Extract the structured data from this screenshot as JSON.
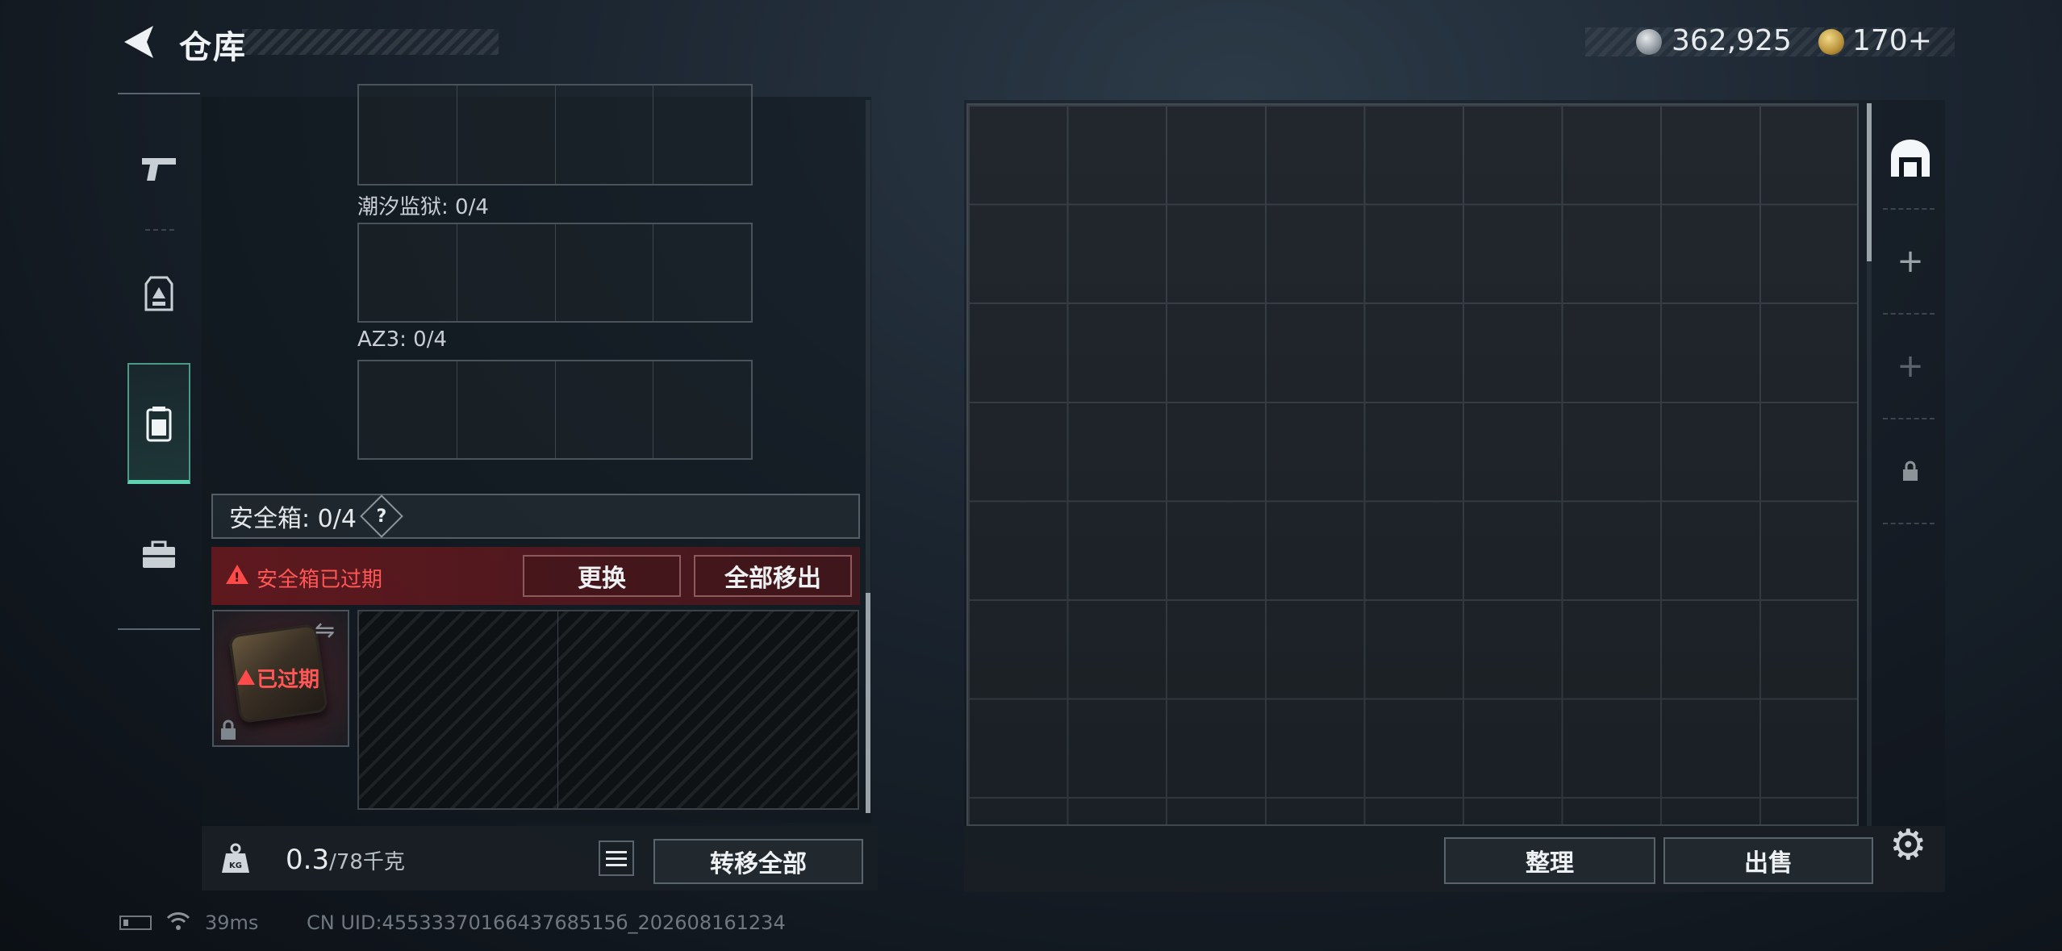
{
  "header": {
    "title": "仓库",
    "currency_silver": "362,925",
    "currency_gold": "170",
    "currency_gold_plus": "+"
  },
  "left_nav": {
    "items": [
      "pistol-icon",
      "armor-vest-icon",
      "backpack-icon",
      "toolbox-icon"
    ],
    "active_index": 2
  },
  "slots": [
    {
      "label": "潮汐监狱: 0/4"
    },
    {
      "label": "AZ3: 0/4"
    }
  ],
  "safe_box": {
    "label": "安全箱:",
    "count": "0/4",
    "help": "?",
    "expired_notice": "安全箱已过期",
    "replace_label": "更换",
    "move_all_label": "全部移出",
    "case_status": "已过期"
  },
  "weight": {
    "current": "0.3",
    "max": "/78千克",
    "transfer_all_label": "转移全部"
  },
  "storage": {
    "sort_label": "整理",
    "sell_label": "出售"
  },
  "right_side": {
    "items": [
      "storage-icon",
      "plus-icon",
      "plus-icon",
      "lock-icon"
    ]
  },
  "status": {
    "ping": "39ms",
    "uid": "CN UID:4553337016643768515б_202608161234"
  },
  "colors": {
    "accent_green": "#5dd3b0",
    "danger_red": "#ff5656"
  }
}
